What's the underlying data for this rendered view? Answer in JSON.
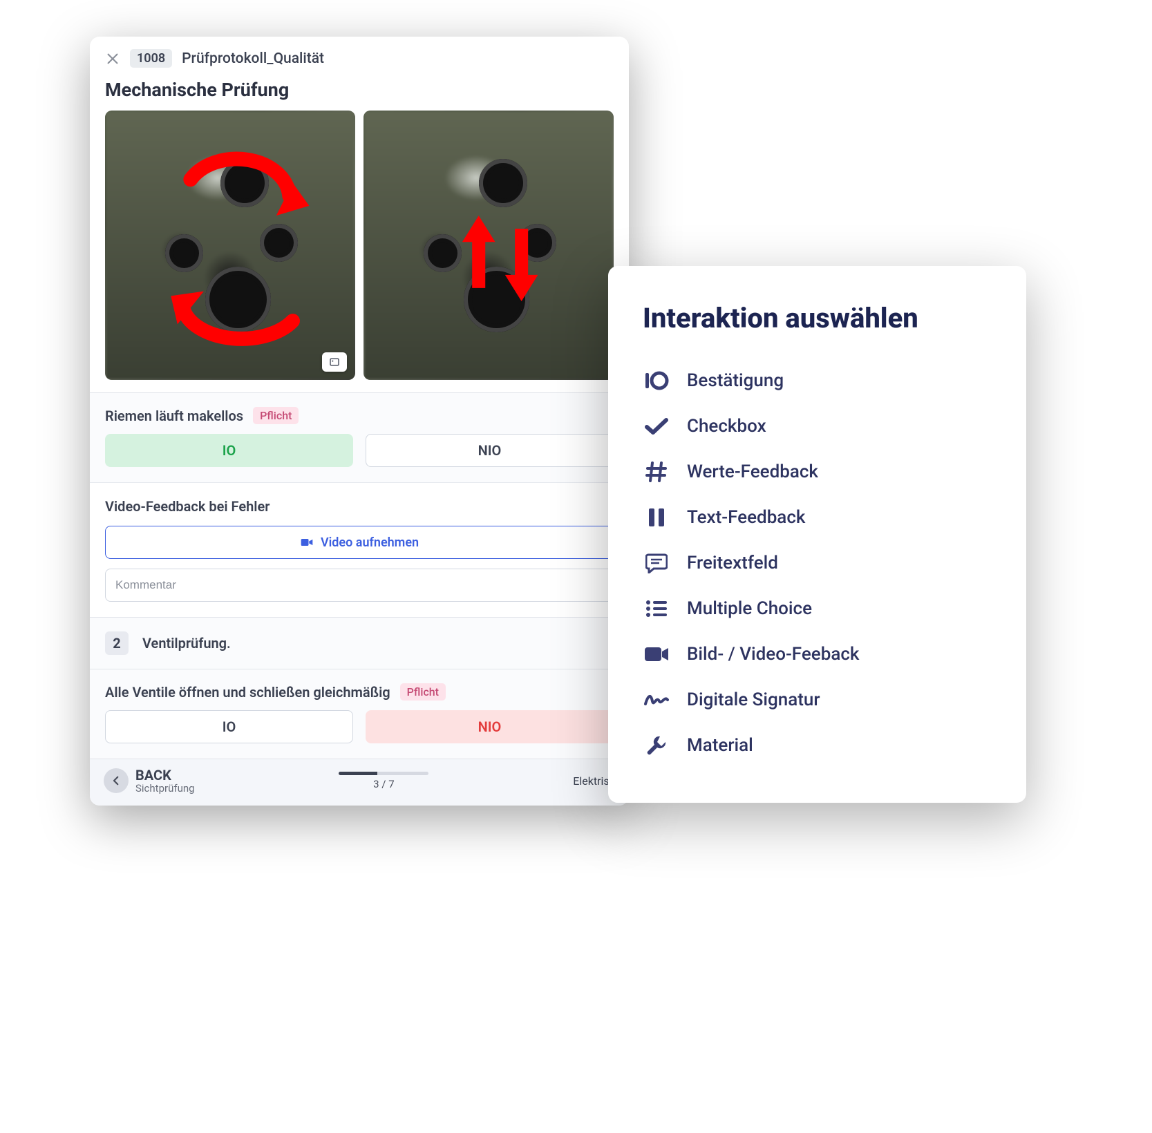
{
  "app": {
    "protocol_id": "1008",
    "protocol_name": "Prüfprotokoll_Qualität",
    "section_title": "Mechanische Prüfung",
    "check1": {
      "label": "Riemen läuft makellos",
      "badge": "Pflicht",
      "io": "IO",
      "nio": "NIO",
      "selected": "io"
    },
    "video_block": {
      "title": "Video-Feedback bei Fehler",
      "button": "Video aufnehmen",
      "comment_placeholder": "Kommentar"
    },
    "step": {
      "num": "2",
      "title": "Ventilprüfung."
    },
    "check2": {
      "label": "Alle Ventile öffnen und schließen gleichmäßig",
      "badge": "Pflicht",
      "io": "IO",
      "nio": "NIO",
      "selected": "nio"
    },
    "footer": {
      "back": "BACK",
      "back_sub": "Sichtprüfung",
      "progress_label": "3 / 7",
      "progress_pct": 43,
      "next": "Elektrisc"
    }
  },
  "panel": {
    "title": "Interaktion auswählen",
    "options": [
      {
        "key": "bestaetigung",
        "label": "Bestätigung",
        "icon": "io-text"
      },
      {
        "key": "checkbox",
        "label": "Checkbox",
        "icon": "check"
      },
      {
        "key": "werte",
        "label": "Werte-Feedback",
        "icon": "hash"
      },
      {
        "key": "text",
        "label": "Text-Feedback",
        "icon": "pause"
      },
      {
        "key": "freitext",
        "label": "Freitextfeld",
        "icon": "chat"
      },
      {
        "key": "multiple",
        "label": "Multiple Choice",
        "icon": "list"
      },
      {
        "key": "media",
        "label": "Bild- / Video-Feeback",
        "icon": "camera"
      },
      {
        "key": "signatur",
        "label": "Digitale Signatur",
        "icon": "squiggle"
      },
      {
        "key": "material",
        "label": "Material",
        "icon": "wrench"
      }
    ]
  }
}
